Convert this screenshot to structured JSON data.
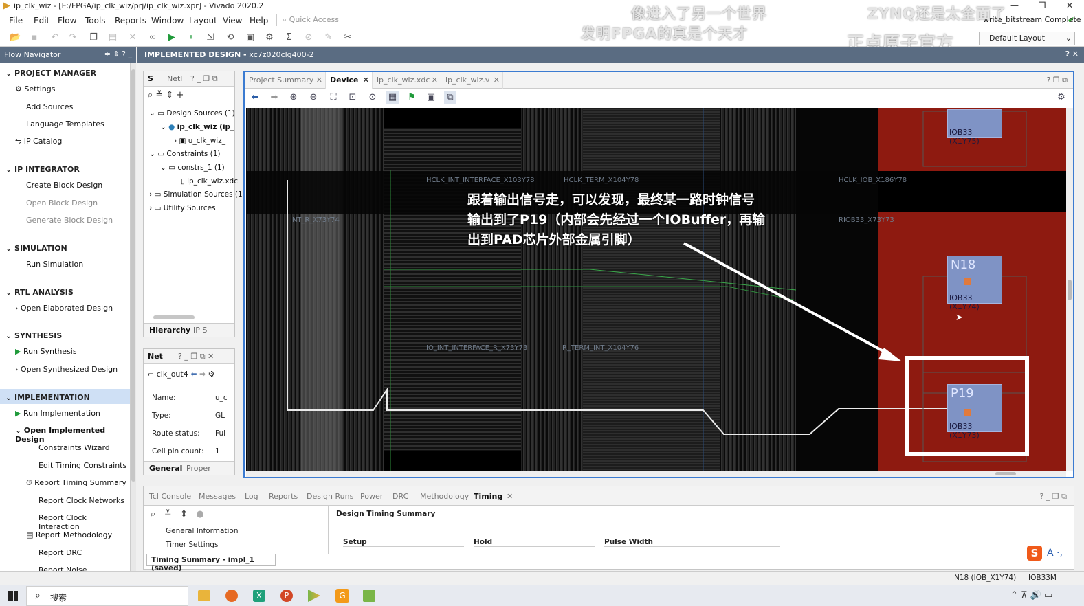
{
  "window": {
    "title": "ip_clk_wiz - [E:/FPGA/ip_clk_wiz/prj/ip_clk_wiz.xpr] - Vivado 2020.2",
    "run_status": "write_bitstream Complete"
  },
  "menu": [
    "File",
    "Edit",
    "Flow",
    "Tools",
    "Reports",
    "Window",
    "Layout",
    "View",
    "Help"
  ],
  "quick_access": "Quick Access",
  "layout_select": "Default Layout",
  "watermarks": {
    "line1": "像进入了另一个世界",
    "line2": "发明FPGA的真是个天才",
    "line3": "ZYNQ还是太全面了",
    "line4": "正点原子官方"
  },
  "flow_navigator": {
    "title": "Flow Navigator",
    "sections": [
      {
        "label": "PROJECT MANAGER",
        "items": [
          "Settings",
          "Add Sources",
          "Language Templates",
          "IP Catalog"
        ]
      },
      {
        "label": "IP INTEGRATOR",
        "items": [
          "Create Block Design",
          "Open Block Design",
          "Generate Block Design"
        ]
      },
      {
        "label": "SIMULATION",
        "items": [
          "Run Simulation"
        ]
      },
      {
        "label": "RTL ANALYSIS",
        "items": [
          "Open Elaborated Design"
        ]
      },
      {
        "label": "SYNTHESIS",
        "items": [
          "Run Synthesis",
          "Open Synthesized Design"
        ]
      },
      {
        "label": "IMPLEMENTATION",
        "items": [
          "Run Implementation",
          "Open Implemented Design",
          "Constraints Wizard",
          "Edit Timing Constraints",
          "Report Timing Summary",
          "Report Clock Networks",
          "Report Clock Interaction",
          "Report Methodology",
          "Report DRC",
          "Report Noise"
        ]
      }
    ]
  },
  "design_header": {
    "label": "IMPLEMENTED DESIGN",
    "part": "xc7z020clg400-2"
  },
  "sources": {
    "tabs": [
      "S",
      "Netl"
    ],
    "tree": [
      "Design Sources (1)",
      "ip_clk_wiz (ip_",
      "u_clk_wiz_",
      "Constraints (1)",
      "constrs_1 (1)",
      "ip_clk_wiz.xdc",
      "Simulation Sources (1",
      "Utility Sources"
    ],
    "bottom_tabs": [
      "Hierarchy",
      "IP S"
    ]
  },
  "net_panel": {
    "title": "Net",
    "net_name": "clk_out4",
    "props": [
      {
        "k": "Name:",
        "v": "u_c"
      },
      {
        "k": "Type:",
        "v": "GL"
      },
      {
        "k": "Route status:",
        "v": "Ful"
      },
      {
        "k": "Cell pin count:",
        "v": "1"
      }
    ],
    "bottom_tabs": [
      "General",
      "Proper"
    ]
  },
  "device": {
    "tabs": [
      "Project Summary",
      "Device",
      "ip_clk_wiz.xdc",
      "ip_clk_wiz.v"
    ],
    "annotation": [
      "跟着输出信号走，可以发现，最终某一路时钟信号",
      "输出到了P19（内部会先经过一个IOBuffer，再输",
      "出到PAD芯片外部金属引脚）"
    ],
    "tiles": [
      {
        "pin": "",
        "label": "IOB33 (X1Y75)"
      },
      {
        "pin": "N18",
        "label": "IOB33 (X1Y74)"
      },
      {
        "pin": "P19",
        "label": "IOB33 (X1Y73)"
      }
    ],
    "grid_labels": [
      "HCLK_IOB_X186Y78",
      "RIOB33_X73Y73",
      "IO_INT_INTERFACE_R_X73Y73",
      "R_TERM_INT_X104Y76",
      "HCLK_INT_INTERFACE_X103Y78",
      "HCLK_TERM_X104Y78",
      "INT_R_X73Y74"
    ]
  },
  "bottom_panel": {
    "tabs": [
      "Tcl Console",
      "Messages",
      "Log",
      "Reports",
      "Design Runs",
      "Power",
      "DRC",
      "Methodology",
      "Timing"
    ],
    "tree_items": [
      "General Information",
      "Timer Settings"
    ],
    "section": "Design Timing Summary",
    "columns": [
      "Setup",
      "Hold",
      "Pulse Width"
    ],
    "result_tab": "Timing Summary - impl_1 (saved)"
  },
  "status_bar": {
    "site": "N18 (IOB_X1Y74)",
    "type": "IOB33M"
  },
  "taskbar": {
    "search": "搜索"
  }
}
